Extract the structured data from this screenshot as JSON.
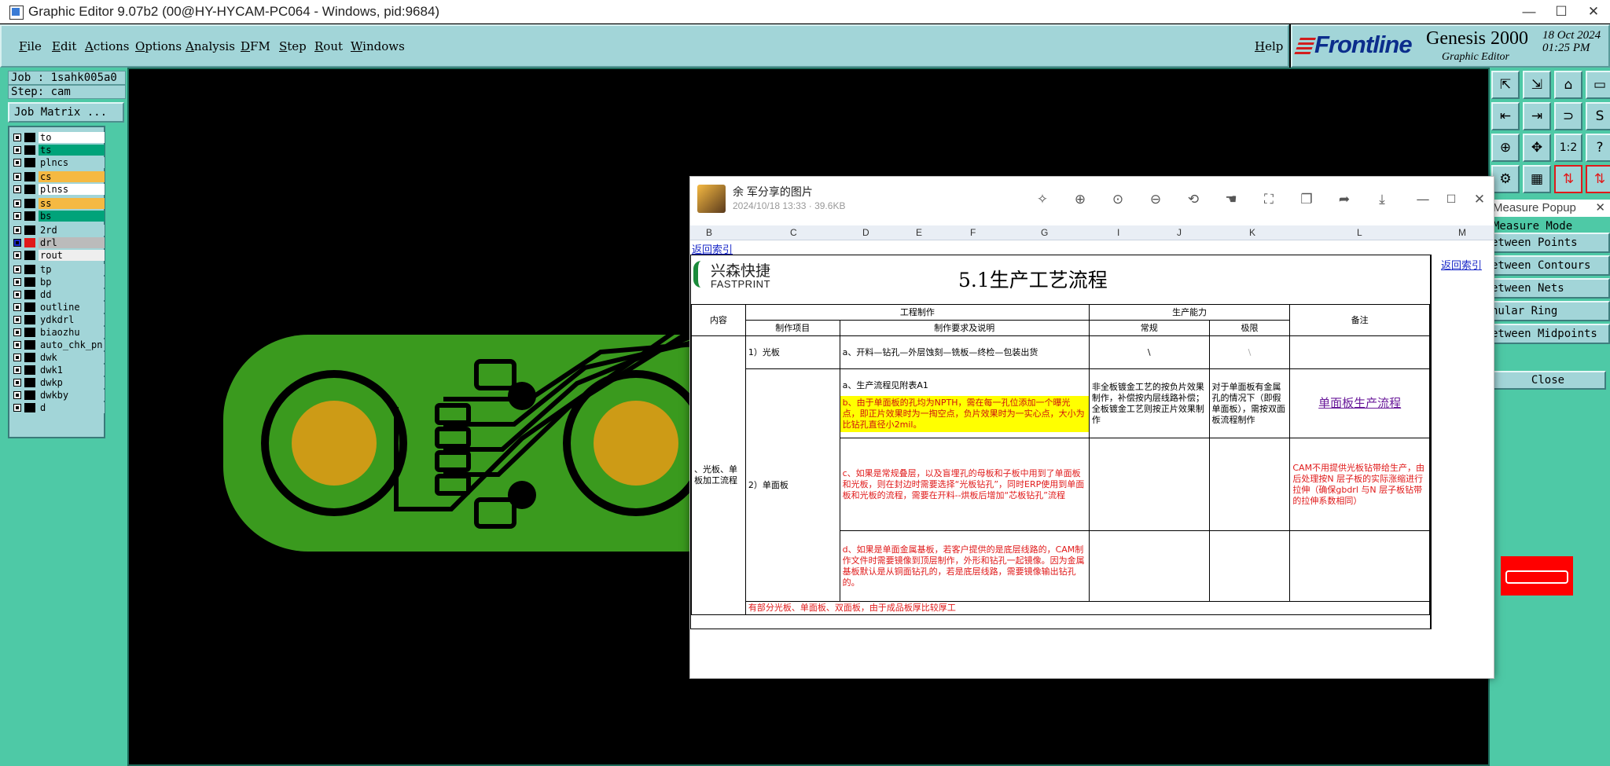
{
  "window": {
    "title": "Graphic Editor 9.07b2 (00@HY-HYCAM-PC064 - Windows, pid:9684)",
    "minimize": "—",
    "maximize": "☐",
    "close": "✕"
  },
  "menubar": {
    "items": [
      "File",
      "Edit",
      "Actions",
      "Options",
      "Analysis",
      "DFM",
      "Step",
      "Rout",
      "Windows"
    ],
    "help": "Help"
  },
  "branding": {
    "logo": "Frontline",
    "product": "Genesis 2000",
    "subtitle": "Graphic Editor",
    "date": "18 Oct 2024",
    "time": "01:25 PM"
  },
  "job": {
    "job_line": "Job : 1sahk005a0",
    "step_line": "Step: cam",
    "matrix_button": "Job Matrix ..."
  },
  "layers": [
    {
      "name": "to",
      "color": "#ffffff"
    },
    {
      "name": "ts",
      "color": "#00a37a"
    },
    {
      "name": "plncs",
      "color": "#a2d5d8"
    },
    {
      "name": "cs",
      "color": "#f5b942"
    },
    {
      "name": "plnss",
      "color": "#ffffff"
    },
    {
      "name": "ss",
      "color": "#f5b942"
    },
    {
      "name": "bs",
      "color": "#00a37a"
    },
    {
      "name": "2rd",
      "color": "#a2d5d8"
    },
    {
      "name": "drl",
      "color": "#bbbbbb"
    },
    {
      "name": "rout",
      "color": "#eeeeee"
    },
    {
      "name": "tp",
      "color": "#a2d5d8"
    },
    {
      "name": "bp",
      "color": "#a2d5d8"
    },
    {
      "name": "dd",
      "color": "#a2d5d8"
    },
    {
      "name": "outline",
      "color": "#a2d5d8"
    },
    {
      "name": "ydkdrl",
      "color": "#a2d5d8"
    },
    {
      "name": "biaozhu",
      "color": "#a2d5d8"
    },
    {
      "name": "auto_chk_pn",
      "color": "#a2d5d8"
    },
    {
      "name": "dwk",
      "color": "#a2d5d8"
    },
    {
      "name": "dwk1",
      "color": "#a2d5d8"
    },
    {
      "name": "dwkp",
      "color": "#a2d5d8"
    },
    {
      "name": "dwkby",
      "color": "#a2d5d8"
    },
    {
      "name": "d",
      "color": "#a2d5d8"
    }
  ],
  "colors": {
    "panel": "#4ec9a6",
    "button": "#a2d5d8",
    "board": "#3a9a1e",
    "pad": "#cd9b16",
    "highlight": "#ff0000"
  },
  "toolbox": {
    "rows": [
      [
        "⇱",
        "⇲",
        "⌂",
        "▭"
      ],
      [
        "⇤",
        "⇥",
        "⊃",
        "S"
      ],
      [
        "⊕",
        "✥",
        "1:2",
        "?"
      ],
      [
        "⚙",
        "▦",
        "⇅",
        "⇅"
      ]
    ]
  },
  "measure": {
    "title": "Measure Popup",
    "close_x": "✕",
    "mode_label": "Measure Mode",
    "options": [
      "etween Points",
      "etween Contours",
      "etween Nets",
      "nular Ring",
      "etween Midpoints"
    ],
    "close_button": "Close"
  },
  "viewer": {
    "sender": "余 军分享的图片",
    "meta": "2024/10/18 13:33 · 39.6KB",
    "tools": [
      "magic-icon",
      "zoom-in-icon",
      "fit-icon",
      "zoom-out-icon",
      "rotate-icon",
      "hand-icon",
      "crop-icon",
      "copy-icon",
      "share-icon",
      "download-icon"
    ],
    "min": "—",
    "max": "☐",
    "close": "✕",
    "columns": [
      "B",
      "C",
      "D",
      "E",
      "F",
      "G",
      "I",
      "J",
      "K",
      "L",
      "M"
    ],
    "back_link": "返回索引",
    "back_link_right": "返回索引",
    "logo_cn": "兴森快捷",
    "logo_en": "FASTPRINT",
    "sheet_title": "5.1生产工艺流程",
    "table": {
      "h_content": "内容",
      "h_engineering": "工程制作",
      "h_capability": "生产能力",
      "h_remark": "备注",
      "h_item": "制作项目",
      "h_requirement": "制作要求及说明",
      "h_normal": "常规",
      "h_limit": "极限",
      "left_label": "、光板、单板加工流程",
      "r1_item": "1）光板",
      "r1_req": "a、开料—钻孔—外层蚀刻—铣板—终检—包装出货",
      "r1_normal": "\\",
      "r1_limit": "\\",
      "r2_item": "2）单面板",
      "r2a": "a、生产流程见附表A1",
      "r2b": "b、由于单面板的孔均为NPTH，需在每一孔位添加一个曝光点，即正片效果时为一掏空点，负片效果时为一实心点，大小为比钻孔直径小2mil。",
      "r2_normal": "非全板镀金工艺的按负片效果制作，补偿按内层线路补偿；全板镀金工艺则按正片效果制作",
      "r2_limit": "对于单面板有金属孔的情况下（即假单面板），需按双面板流程制作",
      "r2_remark_link": "单面板生产流程",
      "r2c": "c、如果是常规叠层，以及盲埋孔的母板和子板中用到了单面板和光板，则在封边时需要选择“光板钻孔”，同时ERP使用到单面板和光板的流程，需要在开料--烘板后增加“芯板钻孔”流程",
      "r2c_remark": "CAM不用提供光板钻带给生产，由后处理按N 层子板的实际涨缩进行拉伸（确保gbdrl 与N 层子板钻带的拉伸系数相同）",
      "r2d": "d、如果是单面金属基板，若客户提供的是底层线路的，CAM制作文件时需要镜像到顶层制作，外形和钻孔一起镜像。因为金属基板默认是从铜面钻孔的，若是底层线路，需要镜像输出钻孔的。",
      "r2e": "有部分光板、单面板、双面板，由于成品板厚比较厚工"
    }
  }
}
